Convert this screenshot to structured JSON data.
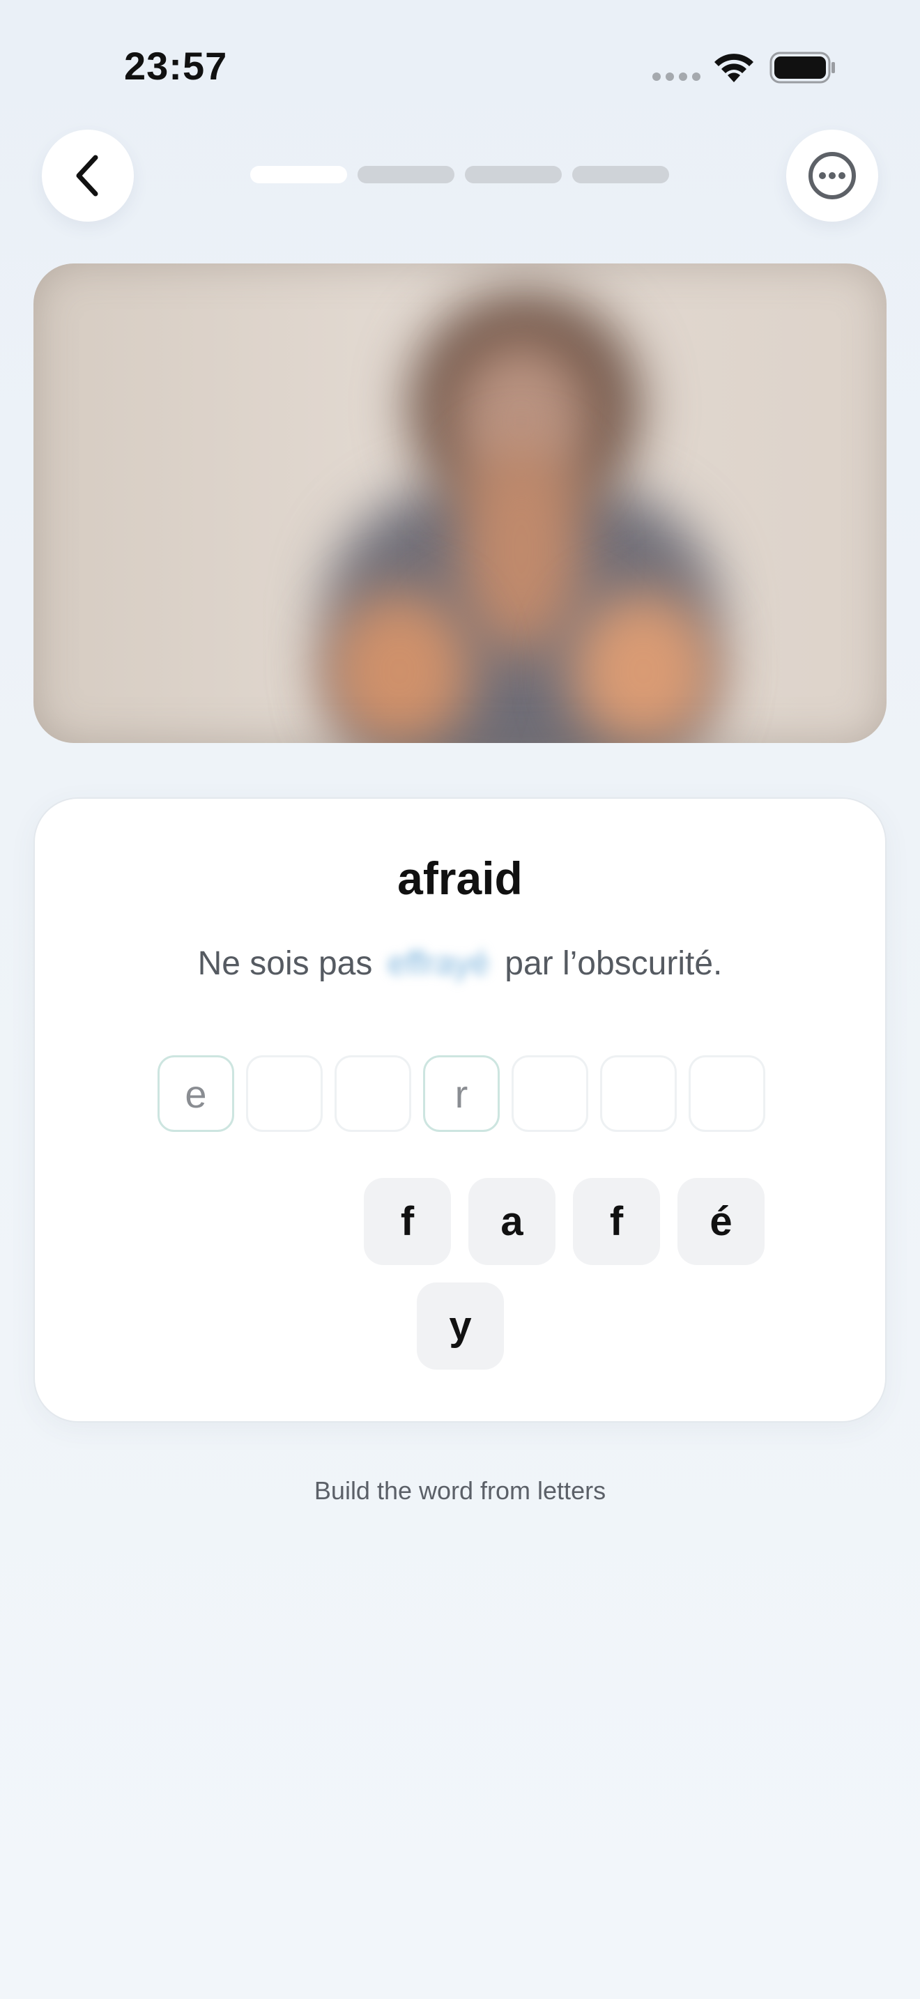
{
  "status_bar": {
    "time": "23:57",
    "icons": [
      "cellular-signal-icon",
      "wifi-icon",
      "battery-icon"
    ]
  },
  "nav": {
    "back_icon": "chevron-left-icon",
    "more_icon": "ellipsis-circle-icon",
    "progress": {
      "total_steps": 4,
      "current_step": 1
    }
  },
  "exercise": {
    "word": "afraid",
    "sentence_before": "Ne sois pas",
    "sentence_blank": "effrayé",
    "sentence_after": "par l’obscurité.",
    "slots": [
      "e",
      "",
      "",
      "r",
      "",
      "",
      ""
    ],
    "tiles_row1": [
      "f",
      "a",
      "f",
      "é"
    ],
    "tiles_row2": [
      "y"
    ],
    "hint": "Build the word from letters"
  },
  "colors": {
    "background": "#eaf0f7",
    "card": "#ffffff",
    "tile": "#f1f2f4",
    "slot_filled_border": "#cde5e0",
    "progress_active": "#ffffff",
    "progress_inactive": "#cfd3d8"
  }
}
